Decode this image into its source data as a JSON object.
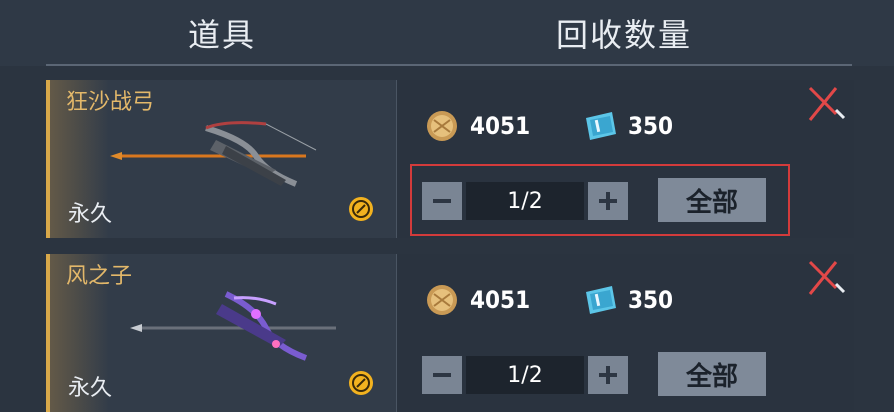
{
  "header": {
    "col_item": "道具",
    "col_qty": "回收数量"
  },
  "rows": [
    {
      "name": "狂沙战弓",
      "duration": "永久",
      "coin_value": "4051",
      "ticket_value": "350",
      "quantity": "1/2",
      "all_label": "全部"
    },
    {
      "name": "风之子",
      "duration": "永久",
      "coin_value": "4051",
      "ticket_value": "350",
      "quantity": "1/2",
      "all_label": "全部"
    }
  ],
  "colors": {
    "name_gold": "#e3b86a",
    "highlight_red": "#d33b3b"
  }
}
